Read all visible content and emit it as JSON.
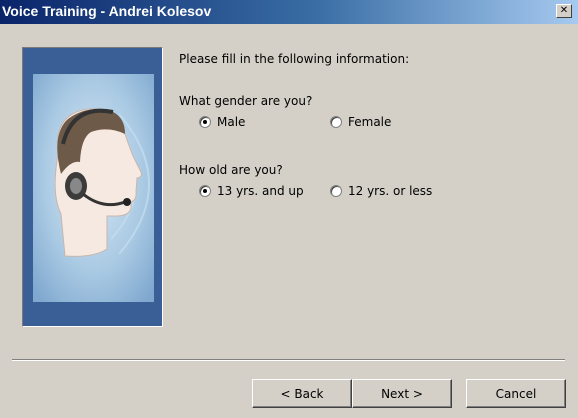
{
  "window": {
    "title": "Voice Training - Andrei Kolesov",
    "close_label": "✕"
  },
  "illustration": {
    "icon": "headset-person-icon"
  },
  "form": {
    "intro": "Please fill in the following information:",
    "gender": {
      "question": "What gender are you?",
      "options": [
        {
          "label": "Male",
          "selected": true
        },
        {
          "label": "Female",
          "selected": false
        }
      ]
    },
    "age": {
      "question": "How old are you?",
      "options": [
        {
          "label": "13 yrs. and up",
          "selected": true
        },
        {
          "label": "12 yrs. or less",
          "selected": false
        }
      ]
    }
  },
  "buttons": {
    "back": "< Back",
    "next": "Next >",
    "cancel": "Cancel"
  },
  "colors": {
    "title_bar_start": "#0a246a",
    "title_bar_end": "#a6caf0",
    "dialog_bg": "#d4d0c8",
    "panel_blue": "#3a5f97"
  }
}
